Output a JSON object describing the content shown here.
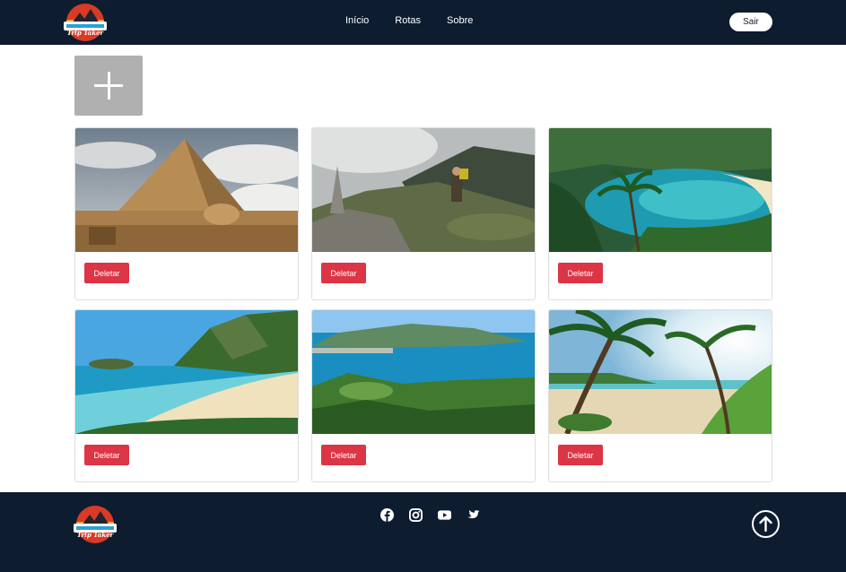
{
  "brand": {
    "name": "Trip Taker"
  },
  "nav": {
    "links": [
      "Início",
      "Rotas",
      "Sobre"
    ],
    "exit_label": "Sair"
  },
  "add_button": {
    "icon": "plus-icon"
  },
  "cards": [
    {
      "scene": "pyramid",
      "delete_label": "Deletar"
    },
    {
      "scene": "hiker",
      "delete_label": "Deletar"
    },
    {
      "scene": "tropical-bay",
      "delete_label": "Deletar"
    },
    {
      "scene": "beach-hill",
      "delete_label": "Deletar"
    },
    {
      "scene": "coastal-view",
      "delete_label": "Deletar"
    },
    {
      "scene": "palm-beach",
      "delete_label": "Deletar"
    }
  ],
  "footer": {
    "social_icons": [
      "facebook-icon",
      "instagram-icon",
      "youtube-icon",
      "twitter-icon"
    ],
    "back_to_top_icon": "arrow-up-circle-icon"
  },
  "colors": {
    "navbar": "#0e1c30",
    "delete": "#dc3545",
    "add_button": "#b0b0b0"
  }
}
